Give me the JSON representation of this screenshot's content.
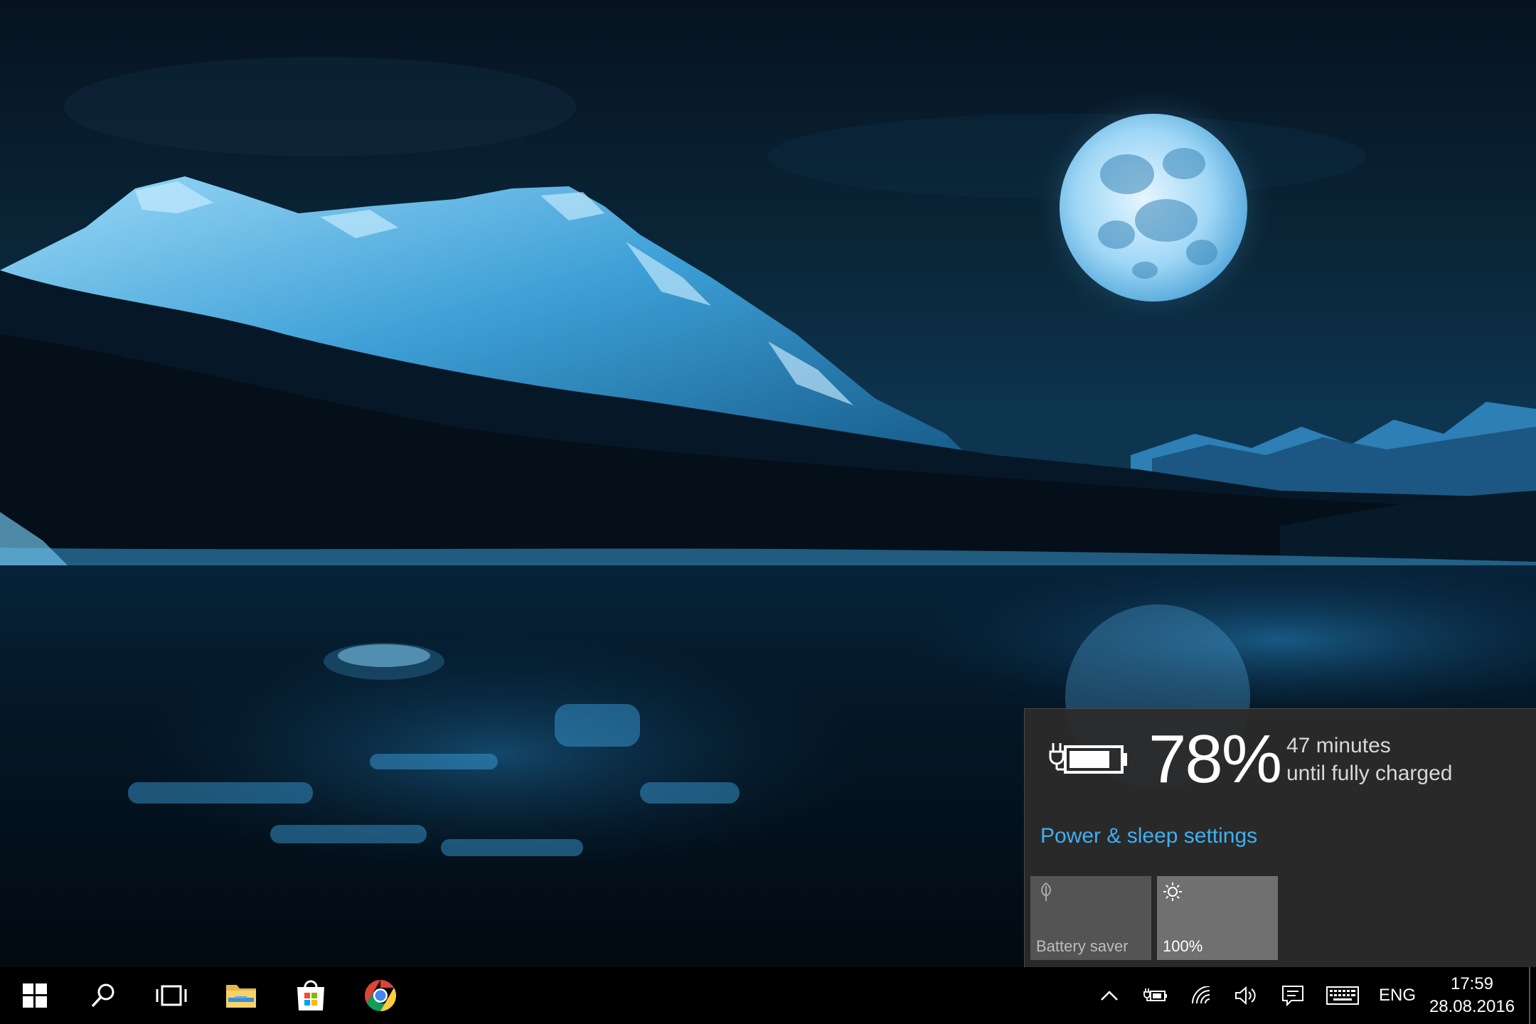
{
  "wallpaper": {
    "description_icon": "night-lake-moon-wallpaper",
    "colors": {
      "sky_top": "#071627",
      "sky_bottom": "#0c3049",
      "moon": "#bfe6ff",
      "mountain_snow": "#6fc3ec",
      "forest": "#05131f",
      "water": "#03101c",
      "water_glow": "#1f78b4"
    }
  },
  "battery_flyout": {
    "icon": "battery-charging-icon",
    "percent": "78%",
    "percent_value": 78,
    "status_line1": "47 minutes",
    "status_line2": "until fully charged",
    "settings_link": "Power & sleep settings",
    "tiles": [
      {
        "icon": "battery-saver-leaf-icon",
        "label": "Battery saver",
        "active": false
      },
      {
        "icon": "brightness-sun-icon",
        "label": "100%",
        "active": true
      }
    ],
    "link_color": "#3fb0f0",
    "background": "#2b2b2b"
  },
  "taskbar": {
    "pinned": [
      {
        "icon": "windows-start-icon",
        "label": "Start"
      },
      {
        "icon": "search-icon",
        "label": "Search"
      },
      {
        "icon": "task-view-icon",
        "label": "Task View"
      },
      {
        "icon": "file-explorer-icon",
        "label": "File Explorer"
      },
      {
        "icon": "store-icon",
        "label": "Store"
      },
      {
        "icon": "chrome-icon",
        "label": "Google Chrome"
      }
    ],
    "tray": [
      {
        "icon": "chevron-up-icon"
      },
      {
        "icon": "battery-charging-icon"
      },
      {
        "icon": "wifi-icon"
      },
      {
        "icon": "volume-icon"
      },
      {
        "icon": "action-center-icon"
      },
      {
        "icon": "keyboard-icon"
      }
    ],
    "language": "ENG",
    "time": "17:59",
    "date": "28.08.2016"
  }
}
